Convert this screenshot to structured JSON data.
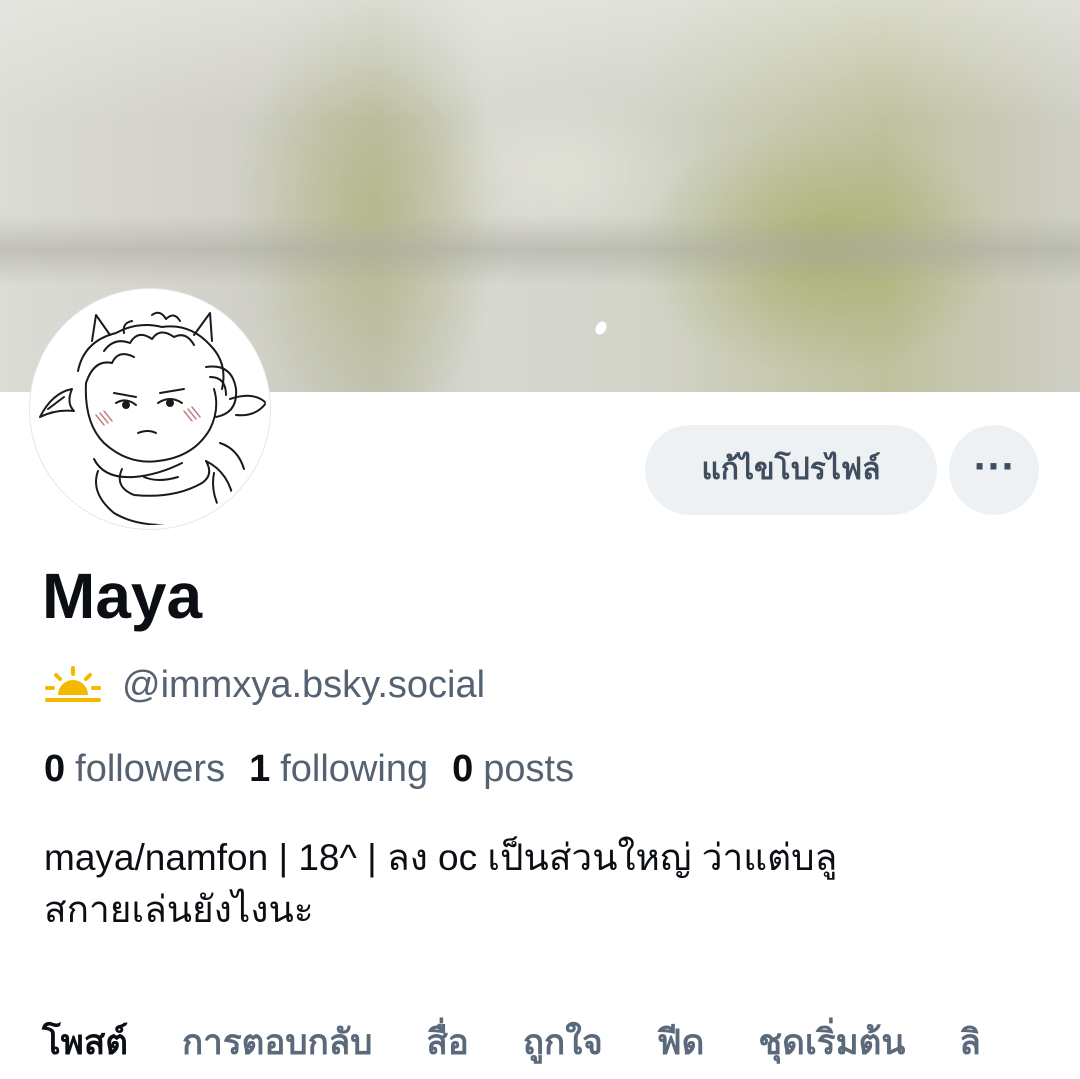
{
  "profile": {
    "display_name": "Maya",
    "handle": "@immxya.bsky.social",
    "handle_icon": "sunrise-icon",
    "bio_lines": [
      "maya/namfon | 18^ | ลง oc เป็นส่วนใหญ่ ว่าแต่บลู",
      "สกายเล่นยังไงนะ"
    ]
  },
  "actions": {
    "edit_label": "แก้ไขโปรไฟล์",
    "more_label": "···"
  },
  "stats": {
    "followers_count": "0",
    "followers_label": "followers",
    "following_count": "1",
    "following_label": "following",
    "posts_count": "0",
    "posts_label": "posts"
  },
  "tabs": [
    {
      "label": "โพสต์",
      "active": true
    },
    {
      "label": "การตอบกลับ",
      "active": false
    },
    {
      "label": "สื่อ",
      "active": false
    },
    {
      "label": "ถูกใจ",
      "active": false
    },
    {
      "label": "ฟีด",
      "active": false
    },
    {
      "label": "ชุดเริ่มต้น",
      "active": false
    },
    {
      "label": "ลิ",
      "active": false
    }
  ],
  "colors": {
    "text_primary": "#0b0f14",
    "text_secondary": "#556271",
    "button_bg": "#eef1f4",
    "tab_inactive": "#5b6a7b",
    "sun_icon": "#f5b800"
  }
}
